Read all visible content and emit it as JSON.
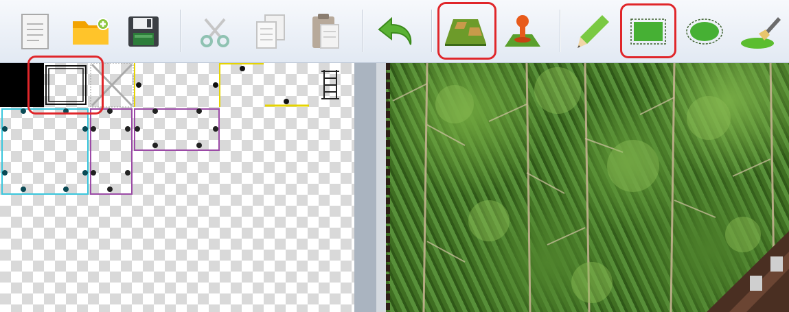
{
  "toolbar": {
    "buttons": [
      {
        "id": "new",
        "icon": "new-document-icon"
      },
      {
        "id": "open",
        "icon": "open-folder-icon"
      },
      {
        "id": "save",
        "icon": "save-floppy-icon"
      },
      {
        "id": "cut",
        "icon": "scissors-icon"
      },
      {
        "id": "copy",
        "icon": "copy-icon"
      },
      {
        "id": "paste",
        "icon": "clipboard-icon"
      },
      {
        "id": "undo",
        "icon": "undo-arrow-icon"
      },
      {
        "id": "map",
        "icon": "map-layer-icon",
        "highlighted": true
      },
      {
        "id": "event",
        "icon": "event-pin-icon"
      },
      {
        "id": "pencil",
        "icon": "pencil-icon"
      },
      {
        "id": "rectangle",
        "icon": "rectangle-icon",
        "highlighted": true
      },
      {
        "id": "ellipse",
        "icon": "ellipse-icon"
      },
      {
        "id": "fill",
        "icon": "fill-brush-icon"
      }
    ]
  },
  "palette": {
    "selected_tile": "passage-tile",
    "highlight_color": "#e0262a"
  },
  "map": {
    "terrain": "forest",
    "accent": "#4f832c"
  }
}
